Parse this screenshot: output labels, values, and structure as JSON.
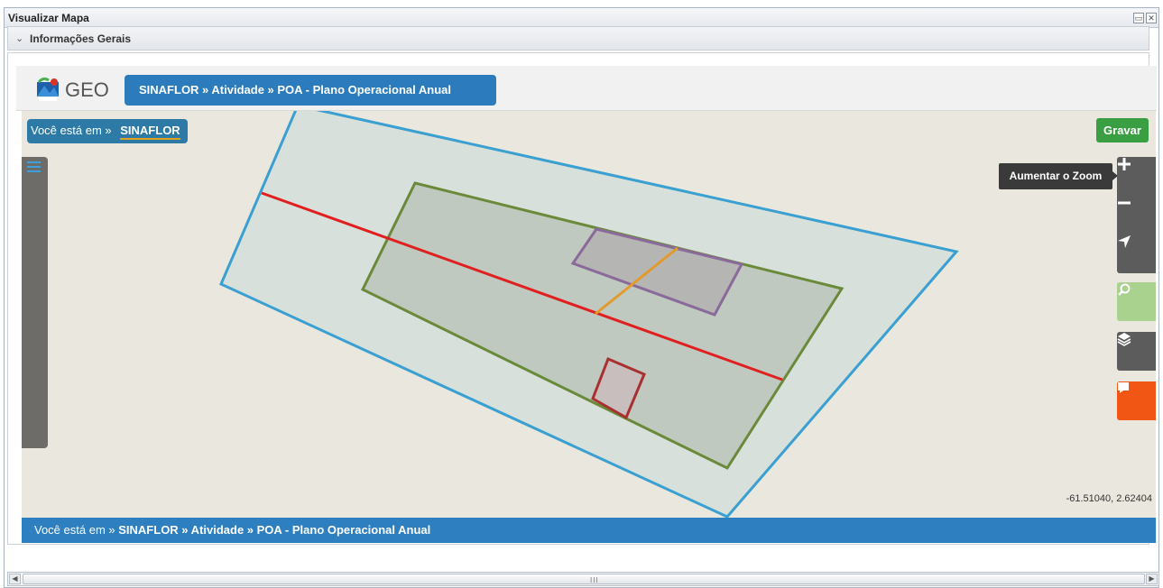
{
  "window": {
    "title": "Visualizar Mapa",
    "maximize_icon": "maximize-icon",
    "close_icon": "close-icon"
  },
  "section": {
    "label": "Informações Gerais",
    "chevron": "⌄"
  },
  "app": {
    "logo_text": "GEO",
    "logo_emblem_text": "IBAMA MMA",
    "breadcrumb_top": "SINAFLOR » Atividade » POA - Plano Operacional Anual"
  },
  "map": {
    "you_are_in_prefix": "Você está em  »",
    "you_are_in_current": "SINAFLOR",
    "save_label": "Gravar",
    "zoom_tooltip": "Aumentar o Zoom",
    "coordinates": "-61.51040, 2.62404",
    "tools": {
      "zoom_in_icon": "plus-icon",
      "zoom_out_icon": "minus-icon",
      "locate_icon": "navigation-arrow-icon",
      "search_icon": "search-icon",
      "layers_icon": "layers-icon",
      "comment_icon": "comment-icon"
    },
    "colors": {
      "background": "#eae8de",
      "outer_polygon": "#3a9fd1",
      "inner_polygon": "#6a8a3a",
      "purple_polygon": "#8a6a9a",
      "red_polygon": "#a83030",
      "red_line": "#e02020",
      "orange_line": "#e39a2a"
    }
  },
  "breadcrumb_bottom": {
    "prefix": "Você está em »",
    "path": "SINAFLOR » Atividade » POA - Plano Operacional Anual"
  },
  "scrollbar": {
    "grip": "III"
  }
}
